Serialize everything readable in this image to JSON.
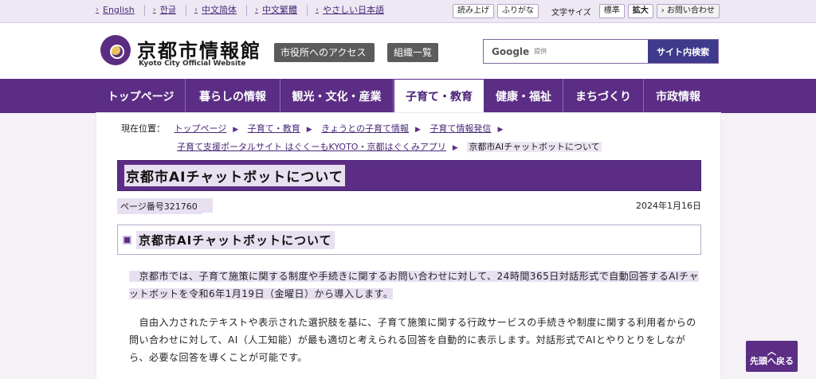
{
  "topbar": {
    "languages": [
      "English",
      "한글",
      "中文简体",
      "中文繁體",
      "やさしい日本語"
    ],
    "read_aloud": "読み上げ",
    "furigana": "ふりがな",
    "font_size_label": "文字サイズ",
    "font_standard": "標準",
    "font_large": "拡大",
    "contact": "お問い合わせ"
  },
  "header": {
    "site_title": "京都市情報館",
    "site_subtitle": "Kyoto City Official Website",
    "access_button": "市役所へのアクセス",
    "org_button": "組織一覧",
    "search_google": "Google",
    "search_provided": "提供",
    "search_button": "サイト内検索"
  },
  "nav": {
    "items": [
      "トップページ",
      "暮らしの情報",
      "観光・文化・産業",
      "子育て・教育",
      "健康・福祉",
      "まちづくり",
      "市政情報"
    ],
    "active_index": 3
  },
  "breadcrumb": {
    "label": "現在位置：",
    "items": [
      "トップページ",
      "子育て・教育",
      "きょうとの子育て情報",
      "子育て情報発信",
      "子育て支援ポータルサイト はぐくーもKYOTO・京都はぐくみアプリ"
    ],
    "current": "京都市AIチャットボットについて"
  },
  "page": {
    "title": "京都市AIチャットボットについて",
    "page_number": "ページ番号321760",
    "date": "2024年1月16日",
    "section_title": "京都市AIチャットボットについて",
    "para1": "京都市では、子育て施策に関する制度や手続きに関するお問い合わせに対して、24時間365日対話形式で自動回答するAIチャットボットを令和6年1月19日（金曜日）から導入します。",
    "para2": "自由入力されたテキストや表示された選択肢を基に、子育て施策に関する行政サービスの手続きや制度に関する利用者からの問い合わせに対して、AI（人工知能）が最も適切と考えられる回答を自動的に表示します。対話形式でAIとやりとりをしながら、必要な回答を導くことが可能です。"
  },
  "back_to_top": "先頭へ戻る",
  "colors": {
    "brand_purple": "#5b2d84",
    "highlight": "#e8e0f1",
    "search_button": "#3f3a8c"
  }
}
